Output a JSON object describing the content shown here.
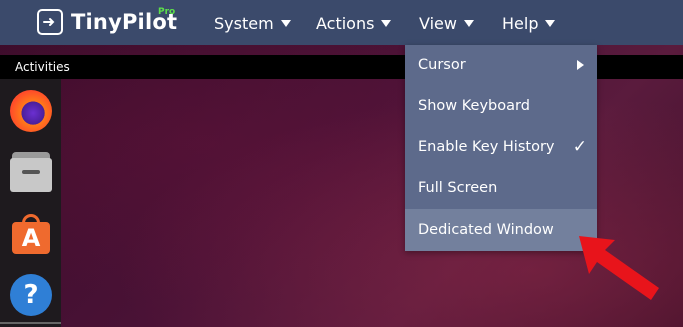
{
  "app": {
    "name": "TinyPilot",
    "badge": "Pro"
  },
  "nav": {
    "system": "System",
    "actions": "Actions",
    "view": "View",
    "help": "Help"
  },
  "desktop": {
    "activities": "Activities",
    "dock": [
      "firefox-icon",
      "files-icon",
      "software-store-icon",
      "help-icon"
    ]
  },
  "view_menu": {
    "items": [
      {
        "label": "Cursor",
        "submenu": true
      },
      {
        "label": "Show Keyboard"
      },
      {
        "label": "Enable Key History",
        "checked": true,
        "check": "✓"
      },
      {
        "label": "Full Screen"
      },
      {
        "label": "Dedicated Window",
        "highlighted": true
      }
    ]
  },
  "colors": {
    "topbar": "#3b4a6b",
    "menu": "#5d6a8b",
    "menu_hover": "#73809d",
    "pro_badge": "#5de04a",
    "annotation_arrow": "#e8141b"
  }
}
